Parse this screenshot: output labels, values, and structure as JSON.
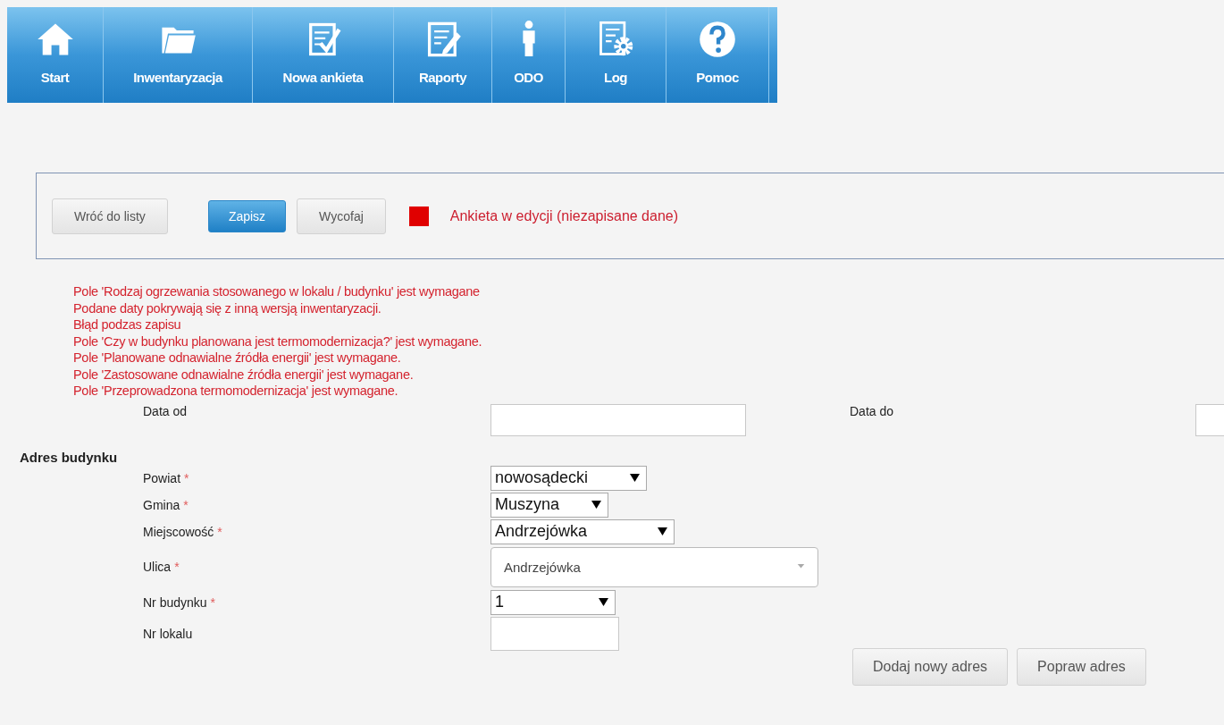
{
  "nav": {
    "items": [
      {
        "label": "Start",
        "selected": false
      },
      {
        "label": "Inwentaryzacja",
        "selected": false
      },
      {
        "label": "Nowa ankieta",
        "selected": false
      },
      {
        "label": "Raporty",
        "selected": false
      },
      {
        "label": "ODO",
        "selected": false
      },
      {
        "label": "Log",
        "selected": false
      },
      {
        "label": "Pomoc",
        "selected": false
      }
    ]
  },
  "toolbar": {
    "buttons": [
      {
        "label": "Wróć do listy",
        "kind": "default"
      },
      {
        "label": "Zapisz",
        "kind": "primary"
      },
      {
        "label": "Wycofaj",
        "kind": "default"
      }
    ],
    "status": {
      "text": "Ankieta w edycji (niezapisane dane)",
      "unsaved": true
    }
  },
  "errors": [
    "Pole 'Rodzaj ogrzewania stosowanego w lokalu / budynku' jest wymagane",
    "Podane daty pokrywają się z inną wersją inwentaryzacji.",
    "Błąd podzas zapisu",
    "Pole 'Czy w budynku planowana jest termomodernizacja?' jest wymagane.",
    "Pole 'Planowane odnawialne źródła energii' jest wymagane.",
    "Pole 'Zastosowane odnawialne źródła energii' jest wymagane.",
    "Pole 'Przeprowadzona termomodernizacja' jest wymagane."
  ],
  "dates": [
    {
      "label": "Data od"
    },
    {
      "label": "Data do"
    }
  ],
  "address": {
    "title": "Adres budynku",
    "fields": [
      {
        "label": "Powiat",
        "marker": "*",
        "kind": "select",
        "value": "nowosądecki"
      },
      {
        "label": "Gmina",
        "marker": "*",
        "kind": "select",
        "value": "Muszyna"
      },
      {
        "label": "Miejscowość",
        "marker": "*",
        "kind": "select",
        "value": "Andrzejówka"
      },
      {
        "label": "Ulica",
        "marker": "*",
        "kind": "combo",
        "value": "Andrzejówka"
      },
      {
        "label": "Nr budynku",
        "marker": "*",
        "kind": "select",
        "value": "1"
      },
      {
        "label": "Nr lokalu",
        "kind": "input"
      }
    ],
    "buttons": [
      "Dodaj nowy adres",
      "Popraw adres"
    ]
  }
}
